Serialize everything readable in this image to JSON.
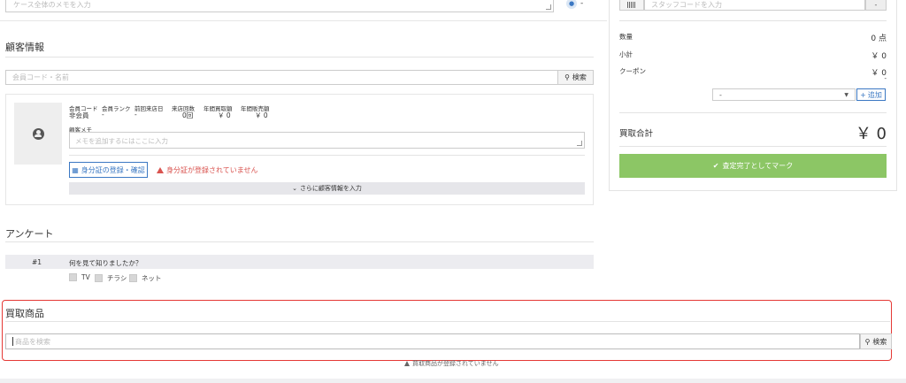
{
  "top": {
    "memo_placeholder": "ケース全体のメモを入力",
    "bell_text": "-"
  },
  "customer": {
    "section_title": "顧客情報",
    "search_placeholder": "会員コード・名前",
    "search_button": "検索",
    "columns": [
      {
        "label": "会員コード",
        "value": "非会員"
      },
      {
        "label": "会員ランク",
        "value": "-"
      },
      {
        "label": "前回来店日",
        "value": "-"
      },
      {
        "label": "来店回数",
        "value": "0回"
      },
      {
        "label": "年間買取額",
        "value": "￥ 0"
      },
      {
        "label": "年間販売額",
        "value": "￥ 0"
      }
    ],
    "memo_label": "顧客メモ",
    "memo_placeholder": "メモを追加するにはここに入力",
    "id_button": "身分証の登録・確認",
    "id_warning": "身分証が登録されていません",
    "more_button": "さらに顧客情報を入力"
  },
  "survey": {
    "section_title": "アンケート",
    "question_number": "#1",
    "question": "何を見て知りましたか？",
    "options": [
      "TV",
      "チラシ",
      "ネット"
    ]
  },
  "purchase": {
    "section_title": "買取商品",
    "search_placeholder": "商品を検索",
    "search_button": "検索",
    "empty_message": "買取商品が登録されていません"
  },
  "summary": {
    "staff_placeholder": "スタッフコードを入力",
    "staff_button": "-",
    "quantity_label": "数量",
    "quantity_value": "0 点",
    "subtotal_label": "小計",
    "subtotal_value": "￥ 0",
    "coupon_label": "クーポン",
    "coupon_value": "￥ 0",
    "coupon_sub": "-",
    "coupon_select": "-",
    "add_button": "追加",
    "total_label": "買取合計",
    "total_value": "￥ 0",
    "complete_button": "査定完了としてマーク"
  },
  "colors": {
    "accent_blue": "#3b78c3",
    "warning_red": "#d9534f",
    "success_green": "#8cc665",
    "highlight_red": "#e53935"
  }
}
